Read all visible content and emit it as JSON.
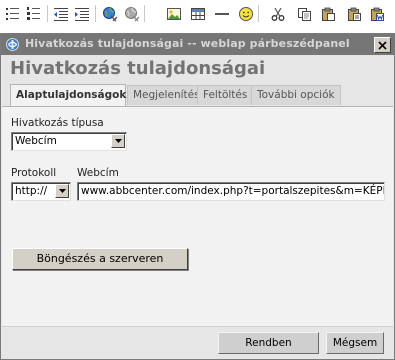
{
  "toolbar": {
    "buttons": [
      {
        "icon": "bullet-list-icon"
      },
      {
        "icon": "numbered-list-icon"
      },
      {
        "icon": "outdent-icon"
      },
      {
        "icon": "indent-icon"
      },
      {
        "icon": "insert-link-icon"
      },
      {
        "icon": "unlink-icon"
      },
      {
        "icon": "insert-image-icon"
      },
      {
        "icon": "insert-table-icon"
      },
      {
        "icon": "horizontal-rule-icon"
      },
      {
        "icon": "smiley-icon"
      },
      {
        "icon": "cut-icon"
      },
      {
        "icon": "copy-icon"
      },
      {
        "icon": "paste-icon"
      },
      {
        "icon": "paste-word-icon"
      }
    ]
  },
  "dialog": {
    "window_title": "Hivatkozás tulajdonságai -- weblap párbeszédpanel",
    "heading": "Hivatkozás tulajdonságai",
    "tabs": [
      {
        "label": "Alaptulajdonságok",
        "active": true
      },
      {
        "label": "Megjelenítés",
        "active": false
      },
      {
        "label": "Feltöltés",
        "active": false
      },
      {
        "label": "További opciók",
        "active": false
      }
    ],
    "link_type": {
      "label": "Hivatkozás típusa",
      "value": "Webcím"
    },
    "protocol": {
      "label": "Protokoll",
      "value": "http://"
    },
    "url": {
      "label": "Webcím",
      "value": "www.abbcenter.com/index.php?t=portalszepites&m=KÉPESLAP"
    },
    "browse_button": "Böngészés a szerveren",
    "ok_button": "Rendben",
    "cancel_button": "Mégsem"
  },
  "colors": {
    "titlebar": "#767676",
    "dialog_bg": "#e6e6e6",
    "panel_bg": "#f2f2f2",
    "heading": "#737373"
  }
}
